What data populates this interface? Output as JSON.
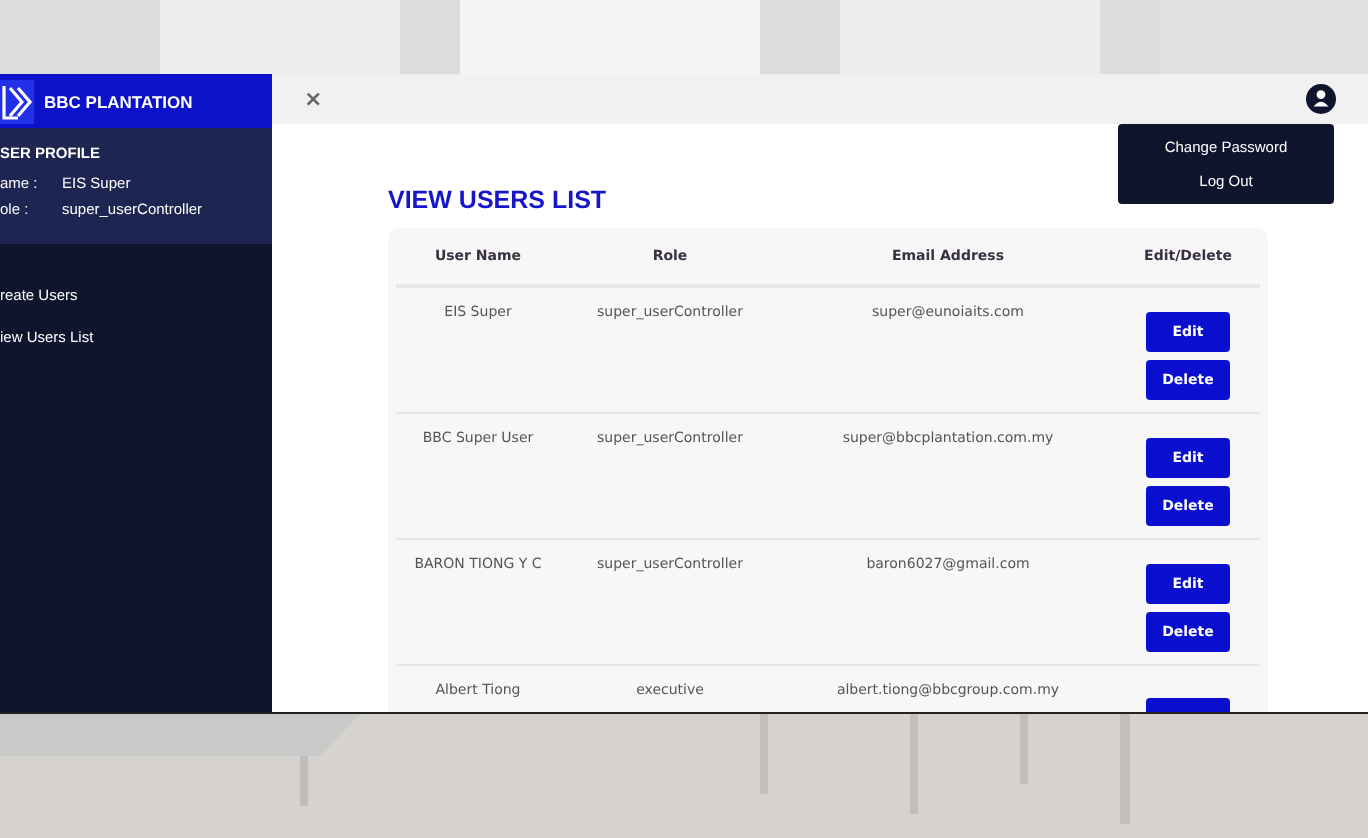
{
  "brand": {
    "name": "BBC PLANTATION"
  },
  "profile": {
    "heading": "SER PROFILE",
    "fields": [
      {
        "label": "ame :",
        "value": "EIS Super"
      },
      {
        "label": "ole :",
        "value": "super_userController"
      }
    ]
  },
  "sidebar": {
    "items": [
      {
        "label": "reate Users",
        "selected": false
      },
      {
        "label": "iew Users List",
        "selected": false
      }
    ]
  },
  "topbar": {
    "close": "×"
  },
  "user_menu": {
    "items": [
      "Change Password",
      "Log Out"
    ]
  },
  "page": {
    "title": "VIEW USERS LIST"
  },
  "table": {
    "columns": [
      "User Name",
      "Role",
      "Email Address",
      "Edit/Delete"
    ],
    "rows": [
      {
        "kind": "full",
        "name": "EIS Super",
        "role": "super_userController",
        "email": "super@eunoiaits.com",
        "actions": [
          "Edit",
          "Delete"
        ]
      },
      {
        "kind": "full",
        "name": "BBC Super User",
        "role": "super_userController",
        "email": "super@bbcplantation.com.my",
        "actions": [
          "Edit",
          "Delete"
        ]
      },
      {
        "kind": "full",
        "name": "BARON TIONG Y C",
        "role": "super_userController",
        "email": "baron6027@gmail.com",
        "actions": [
          "Edit",
          "Delete"
        ]
      },
      {
        "kind": "cut",
        "name": "Albert Tiong",
        "role": "executive",
        "email": "albert.tiong@bbcgroup.com.my"
      }
    ]
  }
}
